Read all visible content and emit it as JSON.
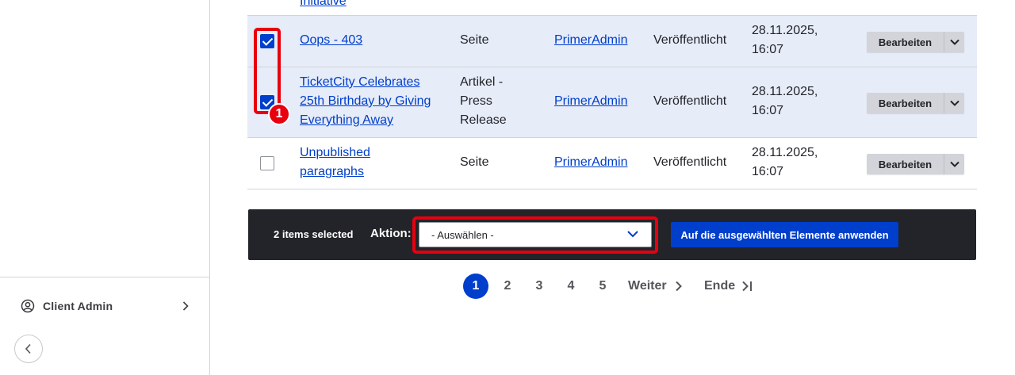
{
  "sidebar": {
    "client_admin_label": "Client Admin"
  },
  "table": {
    "partial_row_title": "Initiative",
    "rows": [
      {
        "title": "Oops - 403",
        "type": "Seite",
        "author": "PrimerAdmin",
        "status": "Veröffentlicht",
        "date": "28.11.2025,",
        "time": "16:07",
        "checked": true,
        "action": "Bearbeiten"
      },
      {
        "title_lines": [
          "TicketCity Celebrates",
          "25th Birthday by Giving",
          "Everything Away"
        ],
        "type_lines": [
          "Artikel -",
          "Press",
          "Release"
        ],
        "author": "PrimerAdmin",
        "status": "Veröffentlicht",
        "date": "28.11.2025,",
        "time": "16:07",
        "checked": true,
        "action": "Bearbeiten"
      },
      {
        "title_lines": [
          "Unpublished",
          "paragraphs"
        ],
        "type": "Seite",
        "author": "PrimerAdmin",
        "status": "Veröffentlicht",
        "date": "28.11.2025,",
        "time": "16:07",
        "checked": false,
        "action": "Bearbeiten"
      }
    ]
  },
  "bulk": {
    "selected_count": "2 items selected",
    "action_label": "Aktion:",
    "select_value": "- Auswählen -",
    "apply_label": "Auf die ausgewählten Elemente anwenden"
  },
  "pager": {
    "pages": [
      "1",
      "2",
      "3",
      "4",
      "5"
    ],
    "current": "1",
    "next_label": "Weiter",
    "last_label": "Ende"
  },
  "annotations": {
    "badge_number": "1",
    "highlight_color": "#e8000f"
  },
  "colors": {
    "accent": "#003ecc",
    "selected_row": "#e6ecf8",
    "bulk_bar": "#232429"
  }
}
